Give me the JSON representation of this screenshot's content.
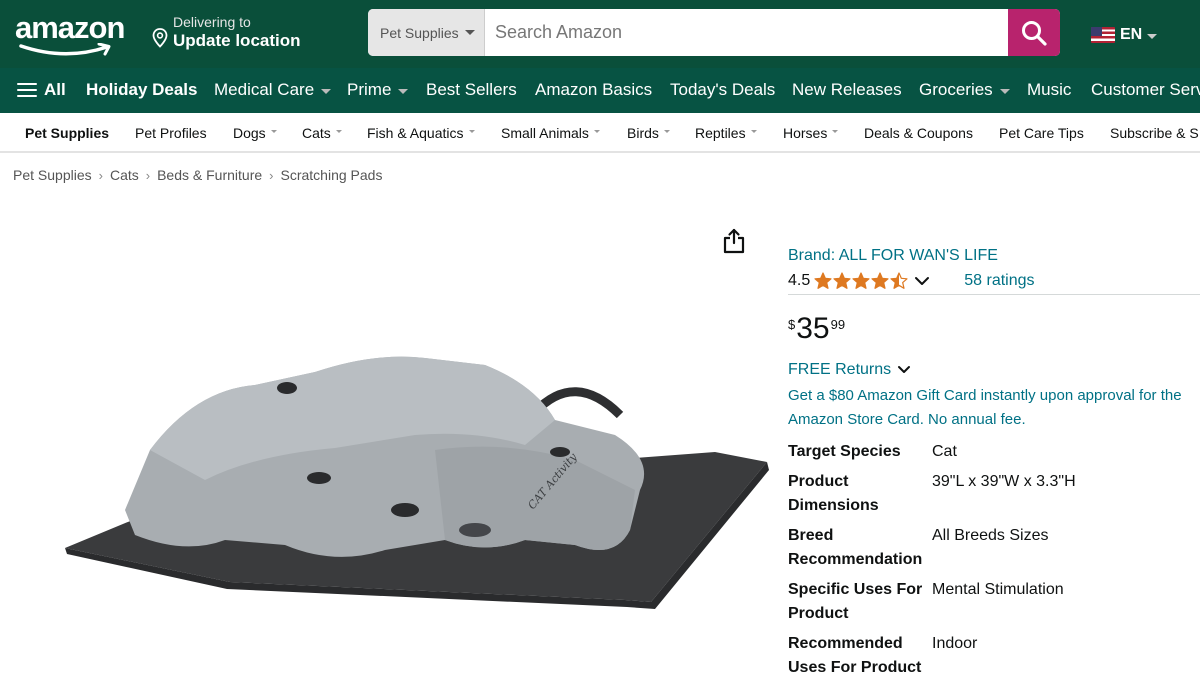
{
  "header": {
    "logo_text": "amazon",
    "deliver_line1": "Delivering to",
    "deliver_line2": "Update location",
    "search_category": "Pet Supplies",
    "search_placeholder": "Search Amazon",
    "language": "EN"
  },
  "main_nav": {
    "items": [
      {
        "label": "All"
      },
      {
        "label": "Holiday Deals"
      },
      {
        "label": "Medical Care"
      },
      {
        "label": "Prime"
      },
      {
        "label": "Best Sellers"
      },
      {
        "label": "Amazon Basics"
      },
      {
        "label": "Today's Deals"
      },
      {
        "label": "New Releases"
      },
      {
        "label": "Groceries"
      },
      {
        "label": "Music"
      },
      {
        "label": "Customer Serv"
      }
    ]
  },
  "sub_nav": {
    "items": [
      {
        "label": "Pet Supplies"
      },
      {
        "label": "Pet Profiles"
      },
      {
        "label": "Dogs"
      },
      {
        "label": "Cats"
      },
      {
        "label": "Fish & Aquatics"
      },
      {
        "label": "Small Animals"
      },
      {
        "label": "Birds"
      },
      {
        "label": "Reptiles"
      },
      {
        "label": "Horses"
      },
      {
        "label": "Deals & Coupons"
      },
      {
        "label": "Pet Care Tips"
      },
      {
        "label": "Subscribe & S"
      }
    ]
  },
  "breadcrumb": [
    "Pet Supplies",
    "Cats",
    "Beds & Furniture",
    "Scratching Pads"
  ],
  "product": {
    "brand": "Brand: ALL FOR WAN'S LIFE",
    "rating": "4.5",
    "rating_value": 4.5,
    "ratings_count": "58 ratings",
    "price_symbol": "$",
    "price_whole": "35",
    "price_fraction": "99",
    "returns": "FREE Returns",
    "promo": "Get a $80 Amazon Gift Card instantly upon approval for the Amazon Store Card. No annual fee.",
    "image_text": "CAT Activity",
    "specs": [
      {
        "key": "Target Species",
        "value": "Cat"
      },
      {
        "key": "Product Dimensions",
        "value": "39\"L x 39\"W x 3.3\"H"
      },
      {
        "key": "Breed Recommendation",
        "value": "All Breeds Sizes"
      },
      {
        "key": "Specific Uses For Product",
        "value": "Mental Stimulation"
      },
      {
        "key": "Recommended Uses For Product",
        "value": "Indoor"
      }
    ]
  },
  "colors": {
    "topbar": "#0a4f3a",
    "nav": "#075343",
    "search_button": "#b8236d",
    "link": "#007185",
    "star": "#de7921"
  }
}
